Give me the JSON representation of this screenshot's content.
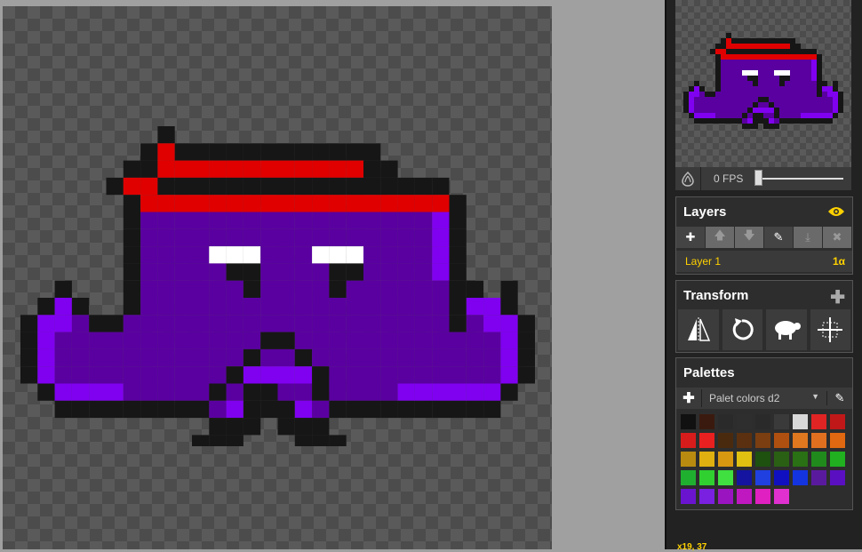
{
  "preview": {
    "fps_label": "0 FPS",
    "fps_value": 0
  },
  "layers": {
    "title": "Layers",
    "items": [
      {
        "name": "Layer 1",
        "alpha": "1α"
      }
    ]
  },
  "transform": {
    "title": "Transform"
  },
  "palettes": {
    "title": "Palettes",
    "selected": "Palet colors d2",
    "colors": [
      "#111111",
      "#3a1a0e",
      "#2a2a2a",
      "#2e2e2e",
      "#2a2a2a",
      "#3a3a3a",
      "#d8d8d8",
      "#e02424",
      "#c01818",
      "#d81c1c",
      "#e82020",
      "#4a2a0e",
      "#5a3010",
      "#7a3e10",
      "#b05010",
      "#e07820",
      "#e07020",
      "#e06810",
      "#b88a10",
      "#e0b010",
      "#d89810",
      "#e0c010",
      "#1e5010",
      "#2a6014",
      "#2a7014",
      "#208a1c",
      "#20b020",
      "#20b030",
      "#30d030",
      "#40e040",
      "#1414a0",
      "#2040e0",
      "#1010c0",
      "#1434e0",
      "#5a1a9e",
      "#5a10c0",
      "#6a14d0",
      "#7a20e0",
      "#9a14c0",
      "#c018c0",
      "#e020c0",
      "#e030d0"
    ]
  },
  "status": {
    "cursor": "x19, 37"
  },
  "sprite": {
    "w": 30,
    "h": 19,
    "colors": {
      "K": "#161616",
      "R": "#e00000",
      "D": "#b80000",
      "P": "#5a00a0",
      "L": "#8000f0",
      "W": "#ffffff"
    },
    "rows": [
      "........K.....................",
      ".......KRKKKKKKKKKKKK.........",
      "......KKRRRRRRRRRRRRKK........",
      ".....KRRKKKKKKKKKKKKKKKKK.....",
      "......KRRRRRRRRRRRRRRRRRRK....",
      "......KPPPPPPPPPPPPPPPPPLK....",
      "......KPPPPPPPPPPPPPPPPPLK....",
      "......KPPPPWWWPPPWWWPPPPLK....",
      "......KPPPPPKKPPPPKKPPPPLK....",
      "..K...KPPPPPPKPPPPKPPPPPPKK.K.",
      ".KLK..KPPPPPPPPPPPPPPPPPPKLLK.",
      "KLLPKKPPPPPPPPPPPPPPPPPPPKPLLK",
      "KLPPPPPPPPPPPPKKPPPPPPPPPPPPLK",
      "KLPPPPPPPPPPPKPPKPPPPPPPPPPPLK",
      "KLPPPPPPPPPPKLLLLKPPPPPPPPPPLK",
      ".KLLLLPPPPPKPKKPPKPPPPLLLLLLK.",
      "..KKKKKKKKKPLKKKLPKKKKKKKKKK..",
      "...........KKK.KKK............",
      "..........KKK...KKK..........."
    ]
  }
}
